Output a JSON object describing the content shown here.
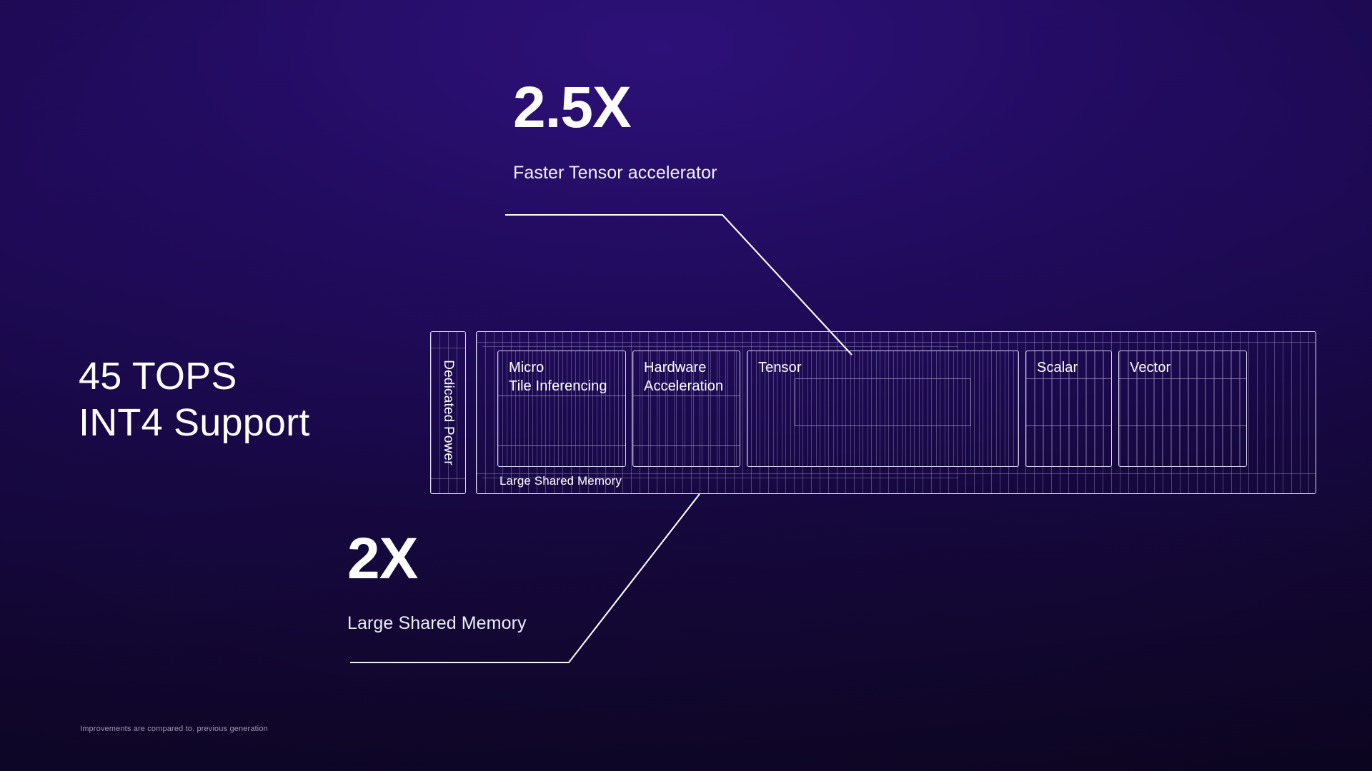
{
  "slide": {
    "headline": "45 TOPS\nINT4 Support",
    "footnote": "Improvements  are compared to. previous generation",
    "accent_color": "#ffffff",
    "background_top": "#1e0a56",
    "background_bottom": "#0e0624"
  },
  "callouts": [
    {
      "id": "tensor-accelerator",
      "value": "2.5X",
      "label": "Faster Tensor accelerator"
    },
    {
      "id": "shared-memory",
      "value": "2X",
      "label": "Large Shared Memory"
    }
  ],
  "chip": {
    "dedicated_power_label": "Dedicated Power",
    "shared_memory_label": "Large Shared Memory",
    "units": [
      {
        "id": "micro-tile-inferencing",
        "label": "Micro\nTile Inferencing"
      },
      {
        "id": "hardware-acceleration",
        "label": "Hardware\nAcceleration"
      },
      {
        "id": "tensor",
        "label": "Tensor"
      },
      {
        "id": "scalar",
        "label": "Scalar"
      },
      {
        "id": "vector",
        "label": "Vector"
      }
    ]
  }
}
